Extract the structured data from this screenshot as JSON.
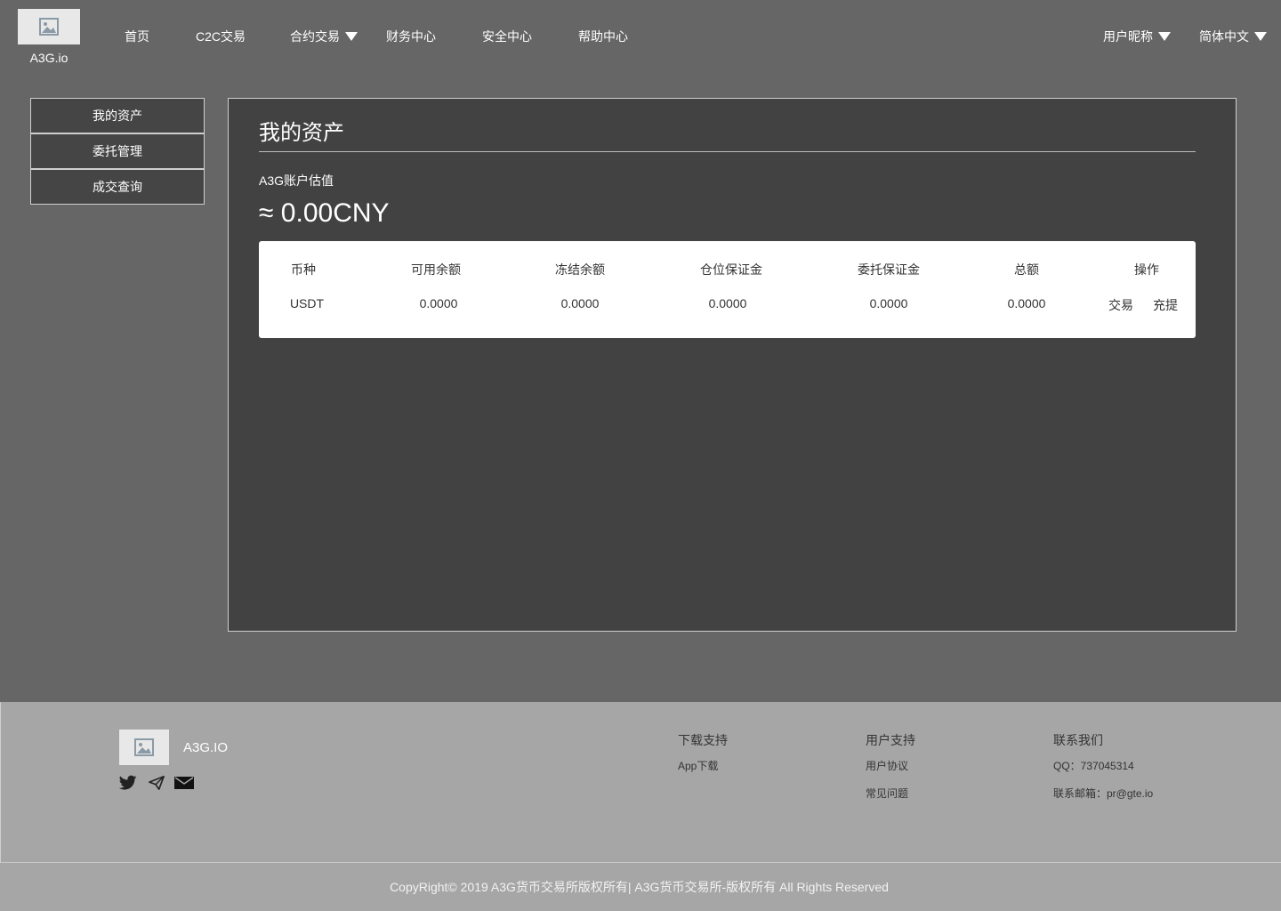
{
  "header": {
    "logo_text": "A3G.io",
    "nav": [
      "首页",
      "C2C交易",
      "合约交易",
      "财务中心",
      "安全中心",
      "帮助中心"
    ],
    "user_label": "用户昵称",
    "language_label": "简体中文"
  },
  "sidebar": {
    "items": [
      {
        "label": "我的资产"
      },
      {
        "label": "委托管理"
      },
      {
        "label": "成交查询"
      }
    ]
  },
  "main": {
    "title": "我的资产",
    "estimate_label": "A3G账户估值",
    "estimate_value": "≈ 0.00CNY",
    "table": {
      "headers": [
        "币种",
        "可用余额",
        "冻结余额",
        "仓位保证金",
        "委托保证金",
        "总额",
        "操作"
      ],
      "rows": [
        {
          "coin": "USDT",
          "available": "0.0000",
          "frozen": "0.0000",
          "position_margin": "0.0000",
          "order_margin": "0.0000",
          "total": "0.0000",
          "actions": [
            "交易",
            "充提"
          ]
        }
      ]
    }
  },
  "footer": {
    "brand": "A3G.IO",
    "columns": [
      {
        "title": "下载支持",
        "links": [
          "App下载"
        ]
      },
      {
        "title": "用户支持",
        "links": [
          "用户协议",
          "常见问题"
        ]
      },
      {
        "title": "联系我们",
        "links": [
          "QQ：737045314",
          "联系邮箱：pr@gte.io"
        ]
      }
    ],
    "copyright": "CopyRight© 2019 A3G货币交易所版权所有| A3G货币交易所-版权所有 All Rights Reserved"
  },
  "icons": {
    "logo": "image-placeholder-icon",
    "footer_logo": "image-placeholder-icon",
    "social": [
      "twitter-icon",
      "telegram-icon",
      "mail-icon"
    ],
    "dropdown": "triangle-down-icon"
  }
}
